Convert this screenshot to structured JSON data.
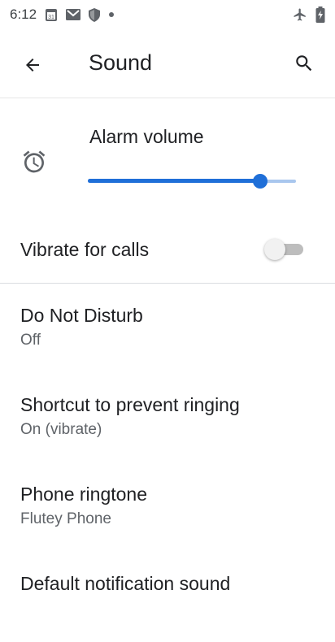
{
  "status_bar": {
    "time": "6:12",
    "left_icons": [
      "calendar-icon",
      "gmail-icon",
      "shield-icon",
      "dot-icon"
    ],
    "right_icons": [
      "airplane-mode-icon",
      "battery-icon"
    ]
  },
  "toolbar": {
    "back_icon": "back-arrow-icon",
    "title": "Sound",
    "search_icon": "search-icon"
  },
  "alarm": {
    "label": "Alarm volume",
    "icon": "alarm-clock-icon",
    "level": 0.83
  },
  "vibrate": {
    "label": "Vibrate for calls",
    "enabled": false
  },
  "settings": [
    {
      "title": "Do Not Disturb",
      "subtitle": "Off"
    },
    {
      "title": "Shortcut to prevent ringing",
      "subtitle": "On (vibrate)"
    },
    {
      "title": "Phone ringtone",
      "subtitle": "Flutey Phone"
    },
    {
      "title": "Default notification sound",
      "subtitle": ""
    }
  ],
  "colors": {
    "accent": "#1f6fd8",
    "accent_light": "#a9c7ee"
  }
}
